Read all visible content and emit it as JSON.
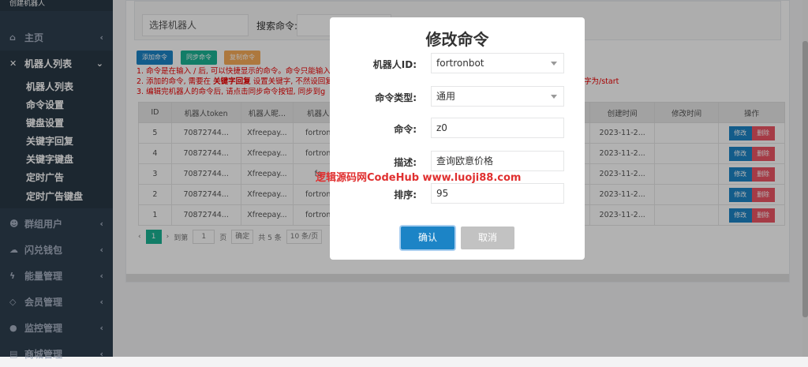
{
  "sidebar": {
    "top_label": "创建机器人",
    "items": [
      {
        "label": "主页",
        "icon": "home-icon"
      },
      {
        "label": "机器人列表",
        "icon": "robot-icon"
      },
      {
        "label": "群组用户",
        "icon": "users-icon"
      },
      {
        "label": "闪兑钱包",
        "icon": "cloud-icon"
      },
      {
        "label": "能量管理",
        "icon": "bolt-icon"
      },
      {
        "label": "会员管理",
        "icon": "diamond-icon"
      },
      {
        "label": "监控管理",
        "icon": "monitor-icon"
      },
      {
        "label": "商城管理",
        "icon": "cart-icon"
      }
    ],
    "subitems": [
      "机器人列表",
      "命令设置",
      "键盘设置",
      "关键字回复",
      "关键字键盘",
      "定时广告",
      "定时广告键盘"
    ]
  },
  "toolbar": {
    "select_placeholder": "选择机器人",
    "search_label": "搜索命令:",
    "add_btn": "添加命令",
    "sync_btn": "同步命令",
    "copy_btn": "复制命令"
  },
  "notes": {
    "n1": "1. 命令是在输入 / 后, 可以快捷显示的命令。命令只能输入",
    "n2a": "2. 添加的命令, 需要在 ",
    "n2b": "关键字回复",
    "n2c": " 设置关键字, 不然设回复",
    "n2d": "字为/start",
    "n3": "3. 编辑完机器人的命令后, 请点击同步命令按钮, 同步到g"
  },
  "table": {
    "headers": [
      "ID",
      "机器人token",
      "机器人昵...",
      "机器人",
      "",
      "",
      "",
      "创建时间",
      "修改时间",
      "操作"
    ],
    "rows": [
      {
        "id": "5",
        "token": "70872744...",
        "nick": "Xfreepay...",
        "bot": "fortron",
        "created": "2023-11-2..."
      },
      {
        "id": "4",
        "token": "70872744...",
        "nick": "Xfreepay...",
        "bot": "fortron",
        "created": "2023-11-2..."
      },
      {
        "id": "3",
        "token": "70872744...",
        "nick": "Xfreepay...",
        "bot": "fo",
        "created": "2023-11-2..."
      },
      {
        "id": "2",
        "token": "70872744...",
        "nick": "Xfreepay...",
        "bot": "fortron",
        "created": "2023-11-2..."
      },
      {
        "id": "1",
        "token": "70872744...",
        "nick": "Xfreepay...",
        "bot": "fortron",
        "created": "2023-11-2..."
      }
    ],
    "edit_label": "修改",
    "delete_label": "删除"
  },
  "pagination": {
    "current": "1",
    "goto": "到第",
    "page_input": "1",
    "page_unit": "页",
    "confirm": "确定",
    "total": "共 5 条",
    "per_page": "10 条/页"
  },
  "modal": {
    "title": "修改命令",
    "fields": [
      {
        "label": "机器人ID:",
        "value": "fortronbot"
      },
      {
        "label": "命令类型:",
        "value": "通用"
      },
      {
        "label": "命令:",
        "value": "z0"
      },
      {
        "label": "描述:",
        "value": "查询欧意价格"
      },
      {
        "label": "排序:",
        "value": "95"
      }
    ],
    "confirm": "确认",
    "cancel": "取消"
  },
  "watermark": "逻辑源码网CodeHub www.luoji88.com",
  "colors": {
    "sidebar": "#2f4050",
    "primary": "#1c84c6",
    "green": "#1ab394",
    "orange": "#f8ac59",
    "danger": "#ed5565",
    "gray": "#bbbbbb"
  }
}
